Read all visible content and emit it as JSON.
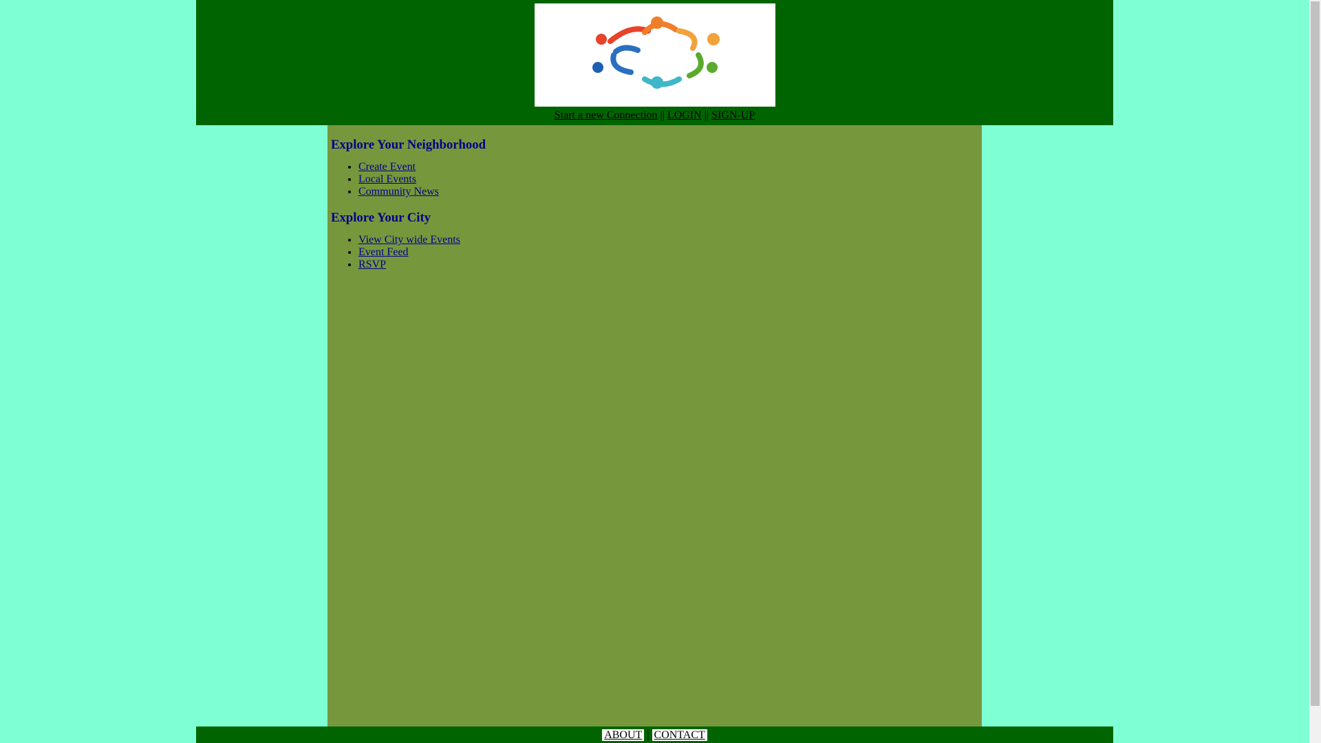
{
  "header": {
    "logo_alt": "community circle logo",
    "nav": [
      {
        "label": "Start a new Connection"
      },
      {
        "label": "LOGIN"
      },
      {
        "label": "SIGN-UP"
      }
    ],
    "separator": "||"
  },
  "content": {
    "sections": [
      {
        "heading": "Explore Your Neighborhood",
        "links": [
          "Create Event",
          "Local Events",
          "Community News"
        ]
      },
      {
        "heading": "Explore Your City",
        "links": [
          "View City wide Events",
          "Event Feed",
          "RSVP"
        ]
      }
    ]
  },
  "footer": {
    "links": [
      {
        "label": "ABOUT"
      },
      {
        "label": "CONTACT"
      }
    ],
    "separator": "|"
  },
  "colors": {
    "page_bg": "#7fffd4",
    "header_bg": "#006400",
    "content_bg": "#77973d",
    "heading": "#00008b",
    "link": "#00008b"
  }
}
